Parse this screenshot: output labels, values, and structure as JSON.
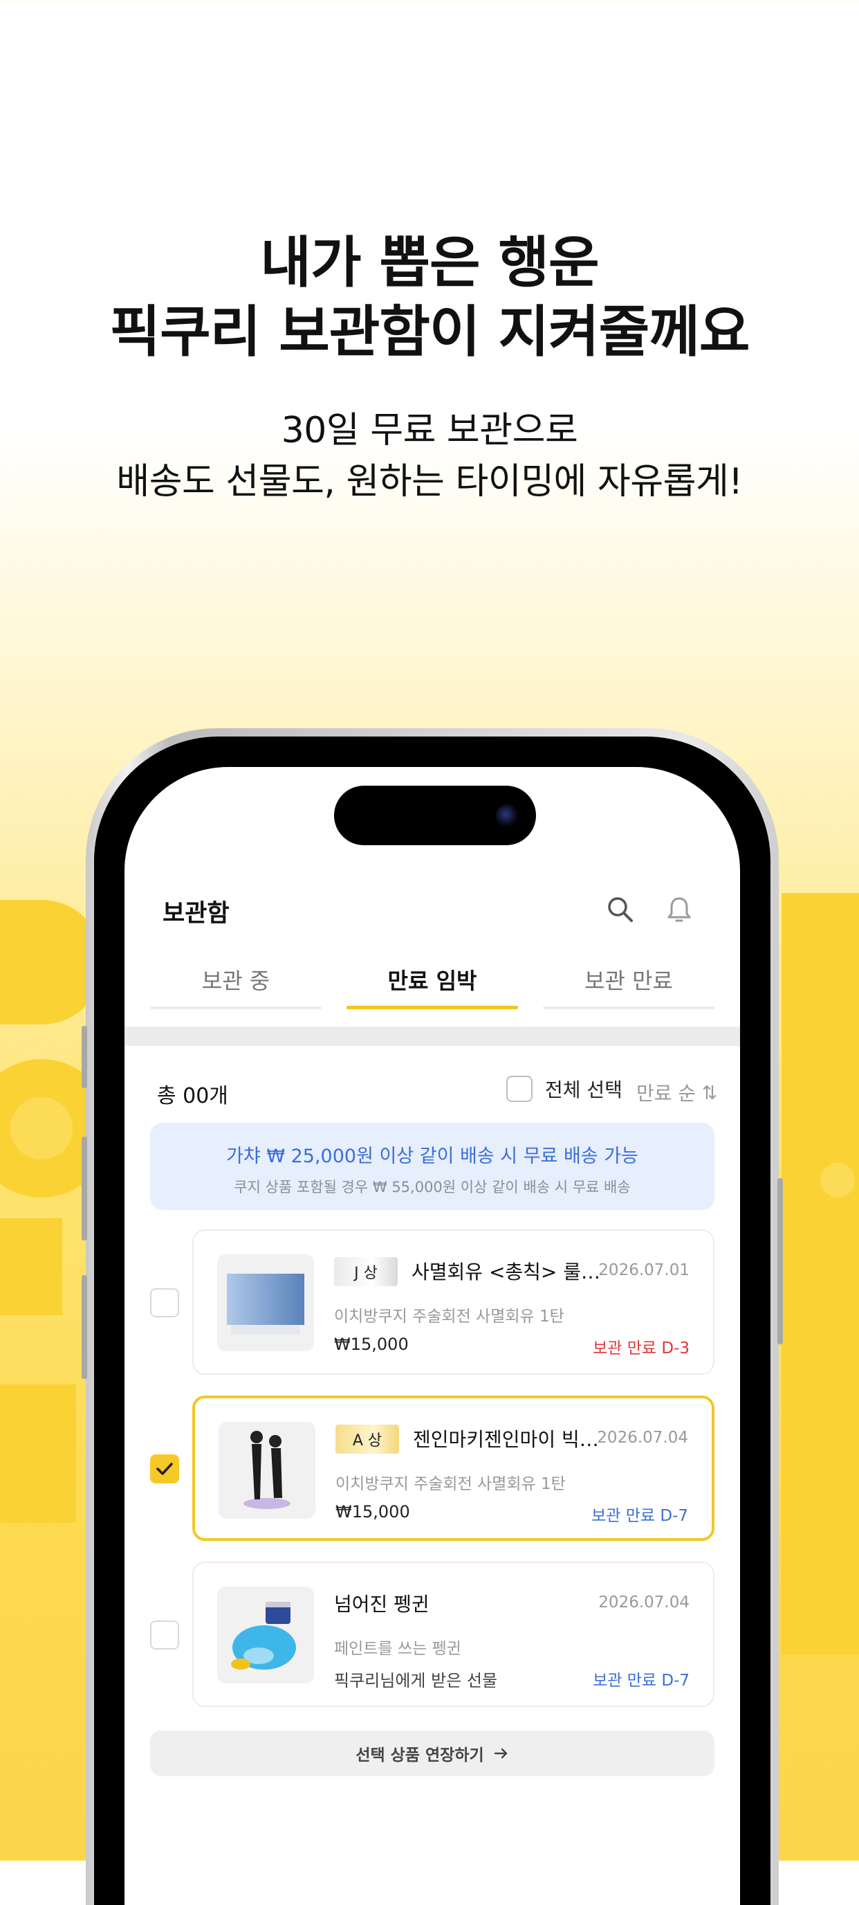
{
  "hero": {
    "headline_line1": "내가 뽑은 행운",
    "headline_line2": "픽쿠리 보관함이 지켜줄께요",
    "subline_line1": "30일 무료 보관으로",
    "subline_line2": "배송도 선물도, 원하는 타이밍에 자유롭게!"
  },
  "app": {
    "title": "보관함",
    "tabs": [
      {
        "label": "보관 중",
        "active": false
      },
      {
        "label": "만료 임박",
        "active": true
      },
      {
        "label": "보관 만료",
        "active": false
      }
    ],
    "count_label": "총 00개",
    "select_all_label": "전체 선택",
    "sort_label": "만료 순",
    "banner": {
      "main": "가챠 ₩ 25,000원 이상 같이 배송 시 무료 배송 가능",
      "sub": "쿠지 상품 포함될 경우 ₩ 55,000원 이상 같이 배송 시 무료 배송"
    },
    "items": [
      {
        "grade": "J 상",
        "name": "사멸회유 <총칙> 룰 아...",
        "date": "2026.07.01",
        "desc": "이치방쿠지 주술회전 사멸회유 1탄",
        "price": "₩15,000",
        "status": "보관 만료 D-3",
        "checked": false
      },
      {
        "grade": "A 상",
        "name": "젠인마키젠인마이 빅 아...",
        "date": "2026.07.04",
        "desc": "이치방쿠지 주술회전 사멸회유 1탄",
        "price": "₩15,000",
        "status": "보관 만료 D-7",
        "checked": true
      },
      {
        "grade": "",
        "name": "넘어진 펭귄",
        "date": "2026.07.04",
        "desc": "페인트를 쓰는 펭귄",
        "price": "픽쿠리님에게 받은 선물",
        "status": "보관 만료 D-7",
        "checked": false
      }
    ],
    "extend_button": "선택 상품 연장하기"
  },
  "colors": {
    "accent_yellow": "#f4c725",
    "status_red": "#e2363a",
    "status_blue": "#3b6fd6",
    "banner_bg": "#e7eefc"
  },
  "icons": [
    "search-icon",
    "bell-icon",
    "sort-icon",
    "check-icon",
    "arrow-right-icon"
  ]
}
